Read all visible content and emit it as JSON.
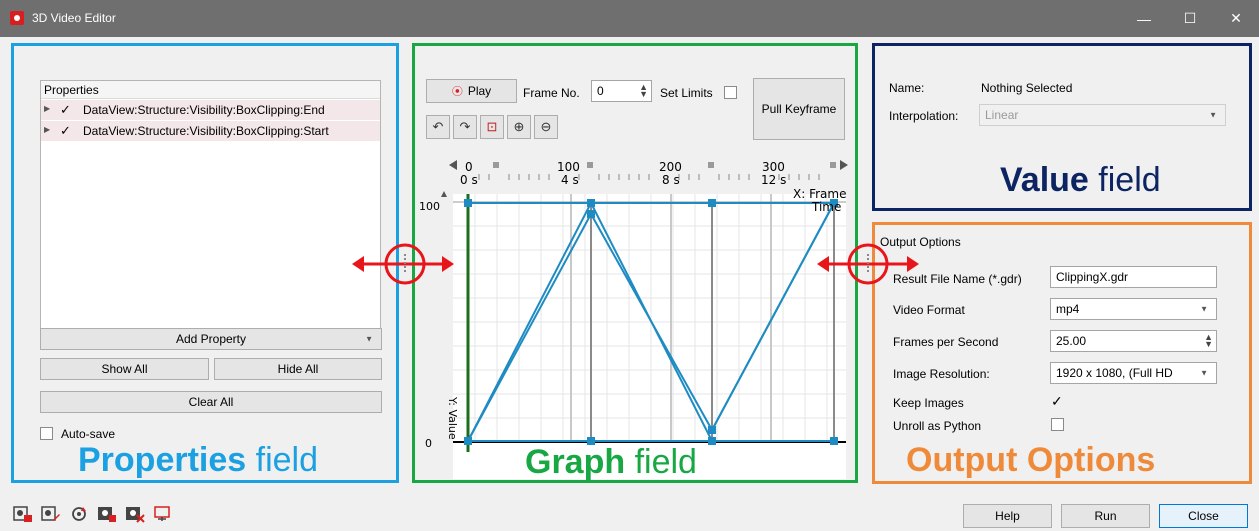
{
  "window": {
    "title": "3D Video Editor",
    "minimize": "—",
    "maximize": "☐",
    "close": "✕"
  },
  "properties": {
    "header": "Properties",
    "items": [
      {
        "label": "DataView:Structure:Visibility:BoxClipping:End",
        "checked": "✓"
      },
      {
        "label": "DataView:Structure:Visibility:BoxClipping:Start",
        "checked": "✓"
      }
    ],
    "add_property": "Add Property",
    "show_all": "Show All",
    "hide_all": "Hide All",
    "clear_all": "Clear All",
    "auto_save": "Auto-save"
  },
  "graph": {
    "play": "Play",
    "frame_no_label": "Frame No.",
    "frame_no_value": "0",
    "set_limits": "Set Limits",
    "pull_keyframe": "Pull Keyframe",
    "axis_top_frames": [
      "0",
      "100",
      "200",
      "300"
    ],
    "axis_top_times": [
      "0 s",
      "4 s",
      "8 s",
      "12 s"
    ],
    "x_axis_label_1": "X: Frame",
    "x_axis_label_2": "Time",
    "y_axis_label": "Y: Value",
    "y_max": "100",
    "y_min": "0"
  },
  "value": {
    "name_label": "Name:",
    "name_value": "Nothing Selected",
    "interpolation_label": "Interpolation:",
    "interpolation_value": "Linear"
  },
  "output": {
    "header": "Output Options",
    "result_file_label": "Result File Name (*.gdr)",
    "result_file_value": "ClippingX.gdr",
    "video_format_label": "Video Format",
    "video_format_value": "mp4",
    "fps_label": "Frames per Second",
    "fps_value": "25.00",
    "resolution_label": "Image Resolution:",
    "resolution_value": "1920 x 1080, (Full HD",
    "keep_images_label": "Keep Images",
    "keep_images_check": "✓",
    "unroll_label": "Unroll as Python"
  },
  "annotations": {
    "properties_bold": "Properties",
    "properties_rest": " field",
    "graph_bold": "Graph",
    "graph_rest": " field",
    "value_bold": "Value",
    "value_rest": " field",
    "output_bold": "Output Options",
    "colors": {
      "properties": "#1ba1e2",
      "graph": "#17a844",
      "value": "#0c2461",
      "output": "#ee8a3a",
      "arrow": "#e8151b"
    }
  },
  "footer": {
    "help": "Help",
    "run": "Run",
    "close": "Close"
  }
}
